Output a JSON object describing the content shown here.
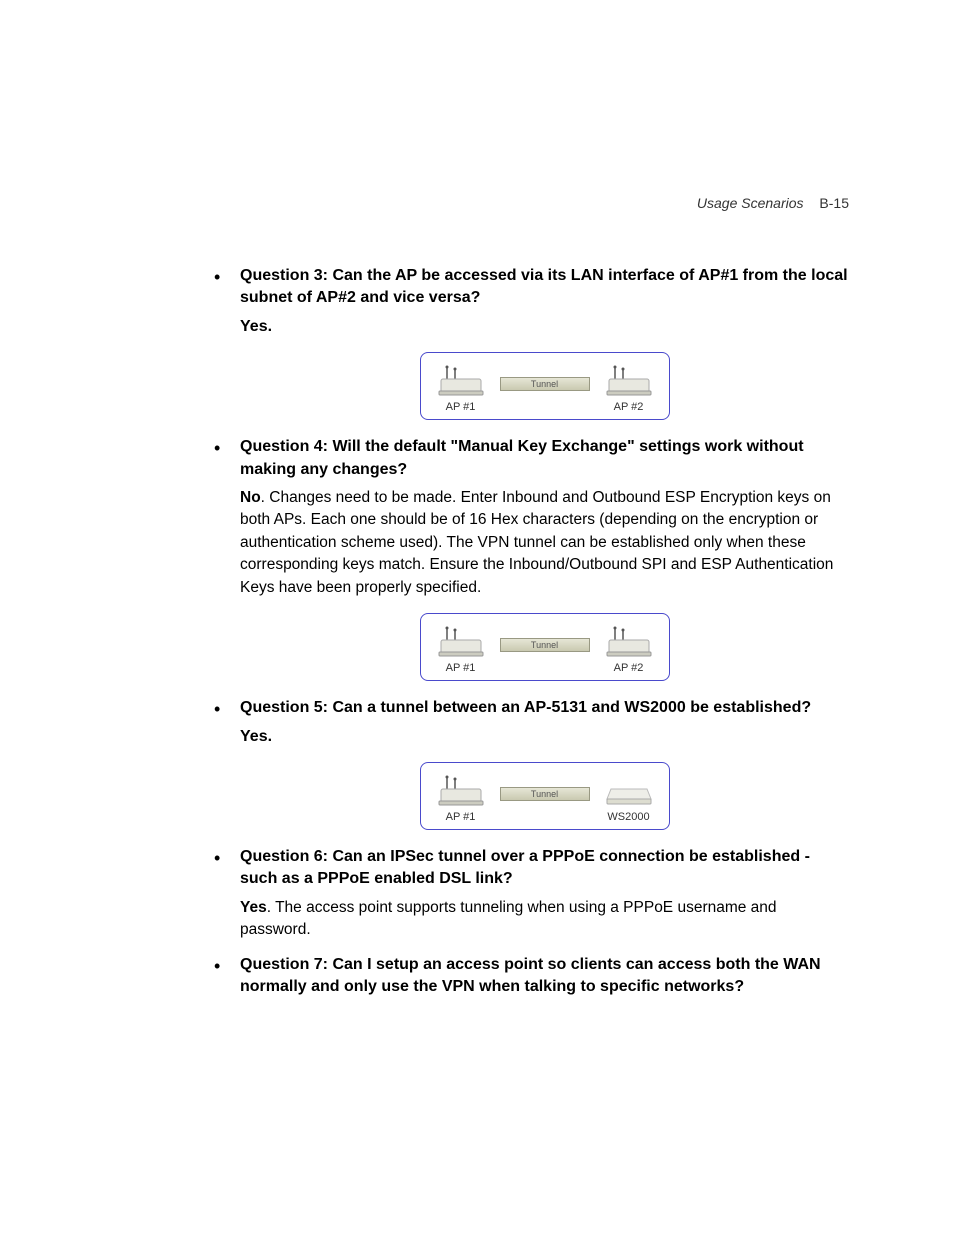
{
  "header": {
    "title": "Usage Scenarios",
    "page": "B-15"
  },
  "items": [
    {
      "question": "Question 3: Can the AP be accessed via its LAN interface of AP#1 from the local subnet of AP#2 and vice versa?",
      "short": "Yes.",
      "body_lead": "",
      "body": "",
      "diagram": {
        "left": "AP #1",
        "right": "AP #2",
        "tunnel": "Tunnel",
        "right_type": "ap"
      }
    },
    {
      "question": "Question 4: Will the default \"Manual Key Exchange\" settings work without making any changes?",
      "short": "",
      "body_lead": "No",
      "body": ". Changes need to be made. Enter Inbound and Outbound ESP Encryption keys on both APs. Each one should be of 16 Hex characters (depending on the encryption or authentication scheme used). The VPN tunnel can be established only when these corresponding keys match. Ensure the Inbound/Outbound SPI and ESP Authentication Keys have been properly specified.",
      "diagram": {
        "left": "AP #1",
        "right": "AP #2",
        "tunnel": "Tunnel",
        "right_type": "ap"
      }
    },
    {
      "question": "Question 5: Can a tunnel between an AP-5131 and WS2000 be established?",
      "short": "Yes.",
      "body_lead": "",
      "body": "",
      "diagram": {
        "left": "AP #1",
        "right": "WS2000",
        "tunnel": "Tunnel",
        "right_type": "ws"
      }
    },
    {
      "question": "Question 6: Can an IPSec tunnel over a PPPoE connection be established - such as a PPPoE enabled DSL link?",
      "short": "",
      "body_lead": "Yes",
      "body": ". The access point supports tunneling when using a PPPoE username and password.",
      "diagram": null
    },
    {
      "question": "Question 7: Can I setup an access point so clients can access both the WAN normally and only use the VPN when talking to specific networks?",
      "short": "",
      "body_lead": "",
      "body": "",
      "diagram": null
    }
  ]
}
